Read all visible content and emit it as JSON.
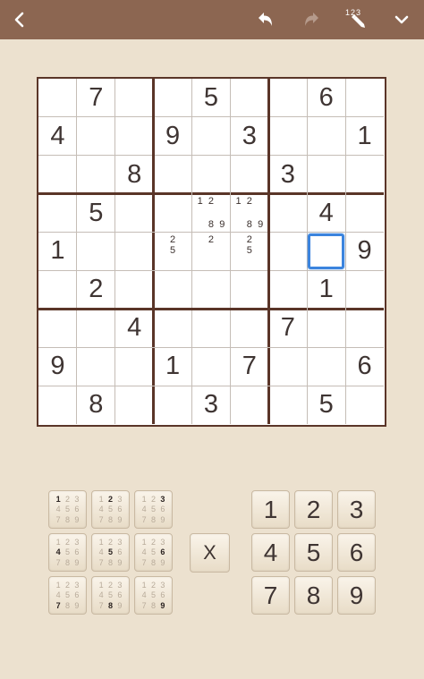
{
  "toolbar": {
    "back_icon": "chevron-left-icon",
    "undo_icon": "undo-icon",
    "redo_icon": "redo-icon",
    "pencil_label": "123",
    "menu_icon": "chevron-down-icon",
    "bar_color": "#8c6651"
  },
  "board": {
    "givens": [
      [
        "",
        "7",
        "",
        "",
        "5",
        "",
        "",
        "6",
        ""
      ],
      [
        "4",
        "",
        "",
        "9",
        "",
        "3",
        "",
        "",
        "1"
      ],
      [
        "",
        "",
        "8",
        "",
        "",
        "",
        "3",
        "",
        ""
      ],
      [
        "",
        "5",
        "",
        "",
        "",
        "",
        "",
        "4",
        ""
      ],
      [
        "1",
        "",
        "",
        "",
        "",
        "",
        "",
        "",
        "9"
      ],
      [
        "",
        "2",
        "",
        "",
        "",
        "",
        "",
        "1",
        ""
      ],
      [
        "",
        "",
        "4",
        "",
        "",
        "",
        "7",
        "",
        ""
      ],
      [
        "9",
        "",
        "",
        "1",
        "",
        "7",
        "",
        "",
        "6"
      ],
      [
        "",
        "8",
        "",
        "",
        "3",
        "",
        "",
        "5",
        ""
      ]
    ],
    "notes": [
      {
        "row": 3,
        "col": 4,
        "digits": [
          "1",
          "2",
          "",
          "",
          "",
          "",
          "",
          "8",
          "9"
        ]
      },
      {
        "row": 3,
        "col": 5,
        "digits": [
          "1",
          "2",
          "",
          "",
          "",
          "",
          "",
          "8",
          "9"
        ]
      },
      {
        "row": 4,
        "col": 3,
        "digits": [
          "",
          "2",
          "",
          "",
          "5",
          "",
          "",
          "",
          ""
        ]
      },
      {
        "row": 4,
        "col": 4,
        "digits": [
          "",
          "2",
          "",
          "",
          "",
          "",
          "",
          "",
          ""
        ]
      },
      {
        "row": 4,
        "col": 5,
        "digits": [
          "",
          "2",
          "",
          "",
          "5",
          "",
          "",
          "",
          ""
        ]
      }
    ],
    "selected": {
      "row": 4,
      "col": 7
    },
    "selected_color": "#3b84de"
  },
  "pencil_pad": {
    "digits": [
      "1",
      "2",
      "3",
      "4",
      "5",
      "6",
      "7",
      "8",
      "9"
    ]
  },
  "clear_label": "X",
  "number_pad": [
    "1",
    "2",
    "3",
    "4",
    "5",
    "6",
    "7",
    "8",
    "9"
  ]
}
